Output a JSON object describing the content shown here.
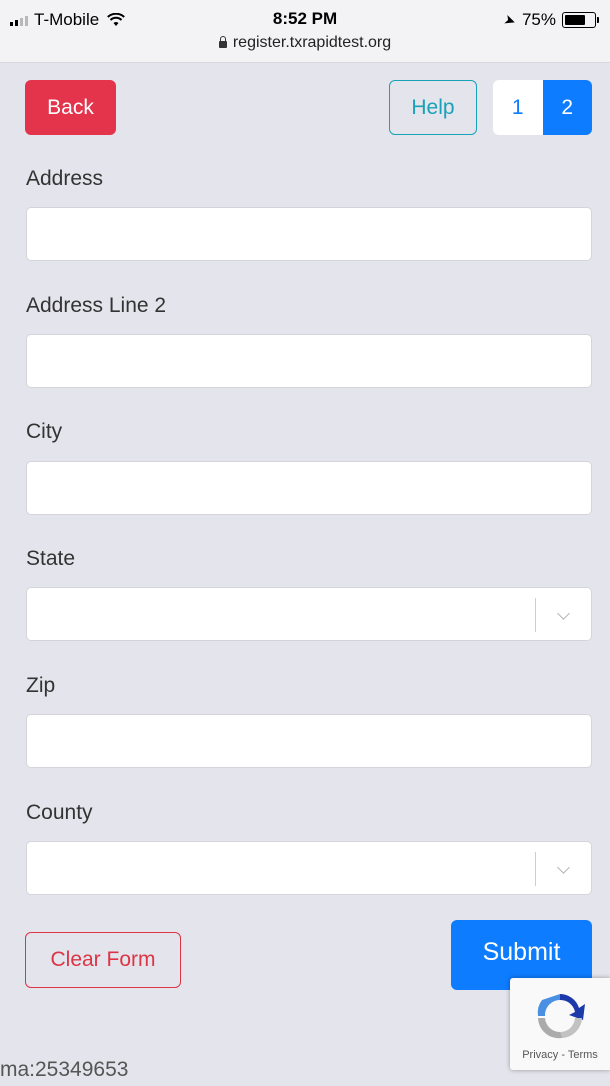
{
  "status_bar": {
    "carrier": "T-Mobile",
    "time": "8:52 PM",
    "url": "register.txrapidtest.org",
    "battery": "75%",
    "battery_level": 0.75
  },
  "header": {
    "back_label": "Back",
    "help_label": "Help",
    "steps": [
      "1",
      "2"
    ],
    "active_step": "2"
  },
  "form": {
    "address_label": "Address",
    "address_value": "",
    "address2_label": "Address Line 2",
    "address2_value": "",
    "city_label": "City",
    "city_value": "",
    "state_label": "State",
    "state_value": "",
    "zip_label": "Zip",
    "zip_value": "",
    "county_label": "County",
    "county_value": ""
  },
  "actions": {
    "clear_label": "Clear Form",
    "submit_label": "Submit"
  },
  "recaptcha": {
    "text": "Privacy - Terms"
  },
  "footer": {
    "id_text": "ma:25349653"
  },
  "colors": {
    "background": "#e4e4ec",
    "danger": "#e3344c",
    "info": "#17a2b8",
    "primary": "#0d7cff"
  },
  "icons": [
    "signal-icon",
    "wifi-icon",
    "lock-icon",
    "location-icon",
    "battery-icon",
    "chevron-down-icon",
    "recaptcha-icon"
  ]
}
